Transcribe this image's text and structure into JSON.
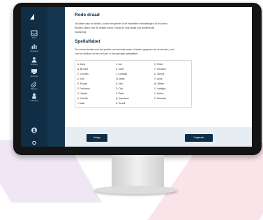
{
  "section1": {
    "title": "Rode draad",
    "paragraph_lines": [
      "Je luistert naar de details, zonder het geheel of de essentiële mededelingen uit te sluiten.",
      "Worden zaken voor de details erover. Houdt de rode draad in je achterhoofd",
      "boodschap"
    ]
  },
  "section2": {
    "title": "Spellalfabet",
    "paragraph_lines": [
      "Om misverstanden met het spellen van iemands naam of andere gegevens te voorkomen, kunt",
      "voor de telefoon uit een de buitr, in een speciaal spellalfabet."
    ]
  },
  "alphabet": {
    "col1": [
      "A. Anna",
      "B. Bernard",
      "C. Cornelis",
      "D. Dirk",
      "E. Eduard",
      "F. Ferdinand",
      "G. Gerard",
      "H. Hendrik",
      "I. Izaak"
    ],
    "col2": [
      "J. Jan",
      "K. Karel",
      "L. Lodewijk",
      "M. Maria",
      "N. Nico",
      "O. Otto",
      "P. Pieter",
      "Q. Quentinus",
      "R. Rudolf"
    ],
    "col3": [
      "S. Simon",
      "T. Theodoor",
      "U. Utrecht",
      "V. Victor",
      "W. Willem",
      "X. Xantippe",
      "Y. Ypsilon",
      "Z. Zaandam"
    ]
  },
  "buttons": {
    "prev": "Vorige",
    "next": "Volgende"
  },
  "sidebar": {
    "items": [
      {
        "label": "Inbox",
        "icon": "inbox-icon"
      },
      {
        "label": "Voortgang",
        "icon": "bar-chart-icon"
      },
      {
        "label": "Groepen",
        "icon": "group-icon"
      },
      {
        "label": "Docenten",
        "icon": "teacher-icon"
      },
      {
        "label": "Bijlagen",
        "icon": "paperclip-icon"
      },
      {
        "label": "Leerlingen",
        "icon": "student-icon"
      }
    ]
  },
  "colors": {
    "sidebar": "#0f2d44",
    "button": "#0f2d44",
    "footer": "#e6eef4"
  }
}
